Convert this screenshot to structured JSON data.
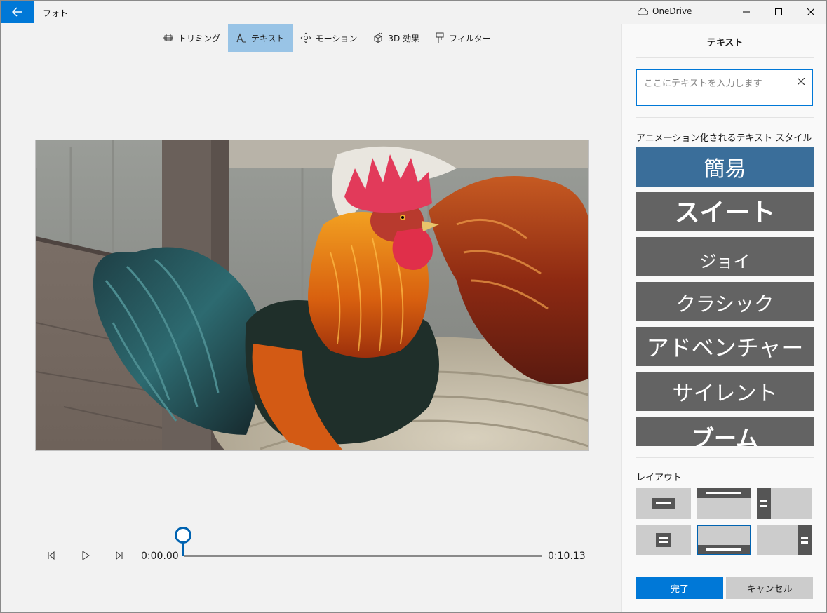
{
  "app": {
    "title": "フォト",
    "onedrive_label": "OneDrive"
  },
  "toolbar": {
    "items": [
      {
        "label": "トリミング",
        "icon": "trim-icon"
      },
      {
        "label": "テキスト",
        "icon": "text-icon",
        "active": true
      },
      {
        "label": "モーション",
        "icon": "motion-icon"
      },
      {
        "label": "3D 効果",
        "icon": "3d-effects-icon"
      },
      {
        "label": "フィルター",
        "icon": "filter-icon"
      }
    ]
  },
  "playback": {
    "current_time": "0:00.00",
    "total_time": "0:10.13",
    "progress": 0
  },
  "panel": {
    "title": "テキスト",
    "input": {
      "value": "",
      "placeholder": "ここにテキストを入力します"
    },
    "styles_heading": "アニメーション化されるテキスト スタイル",
    "styles": [
      {
        "label": "簡易",
        "selected": true
      },
      {
        "label": "スイート"
      },
      {
        "label": "ジョイ"
      },
      {
        "label": "クラシック"
      },
      {
        "label": "アドベンチャー"
      },
      {
        "label": "サイレント"
      },
      {
        "label": "ブーム"
      }
    ],
    "layout_heading": "レイアウト",
    "done_label": "完了",
    "cancel_label": "キャンセル"
  },
  "colors": {
    "accent": "#0078d7",
    "selected_style": "#3a6e9a",
    "style_tile": "#636363",
    "toolbar_active": "#99c4e6"
  }
}
